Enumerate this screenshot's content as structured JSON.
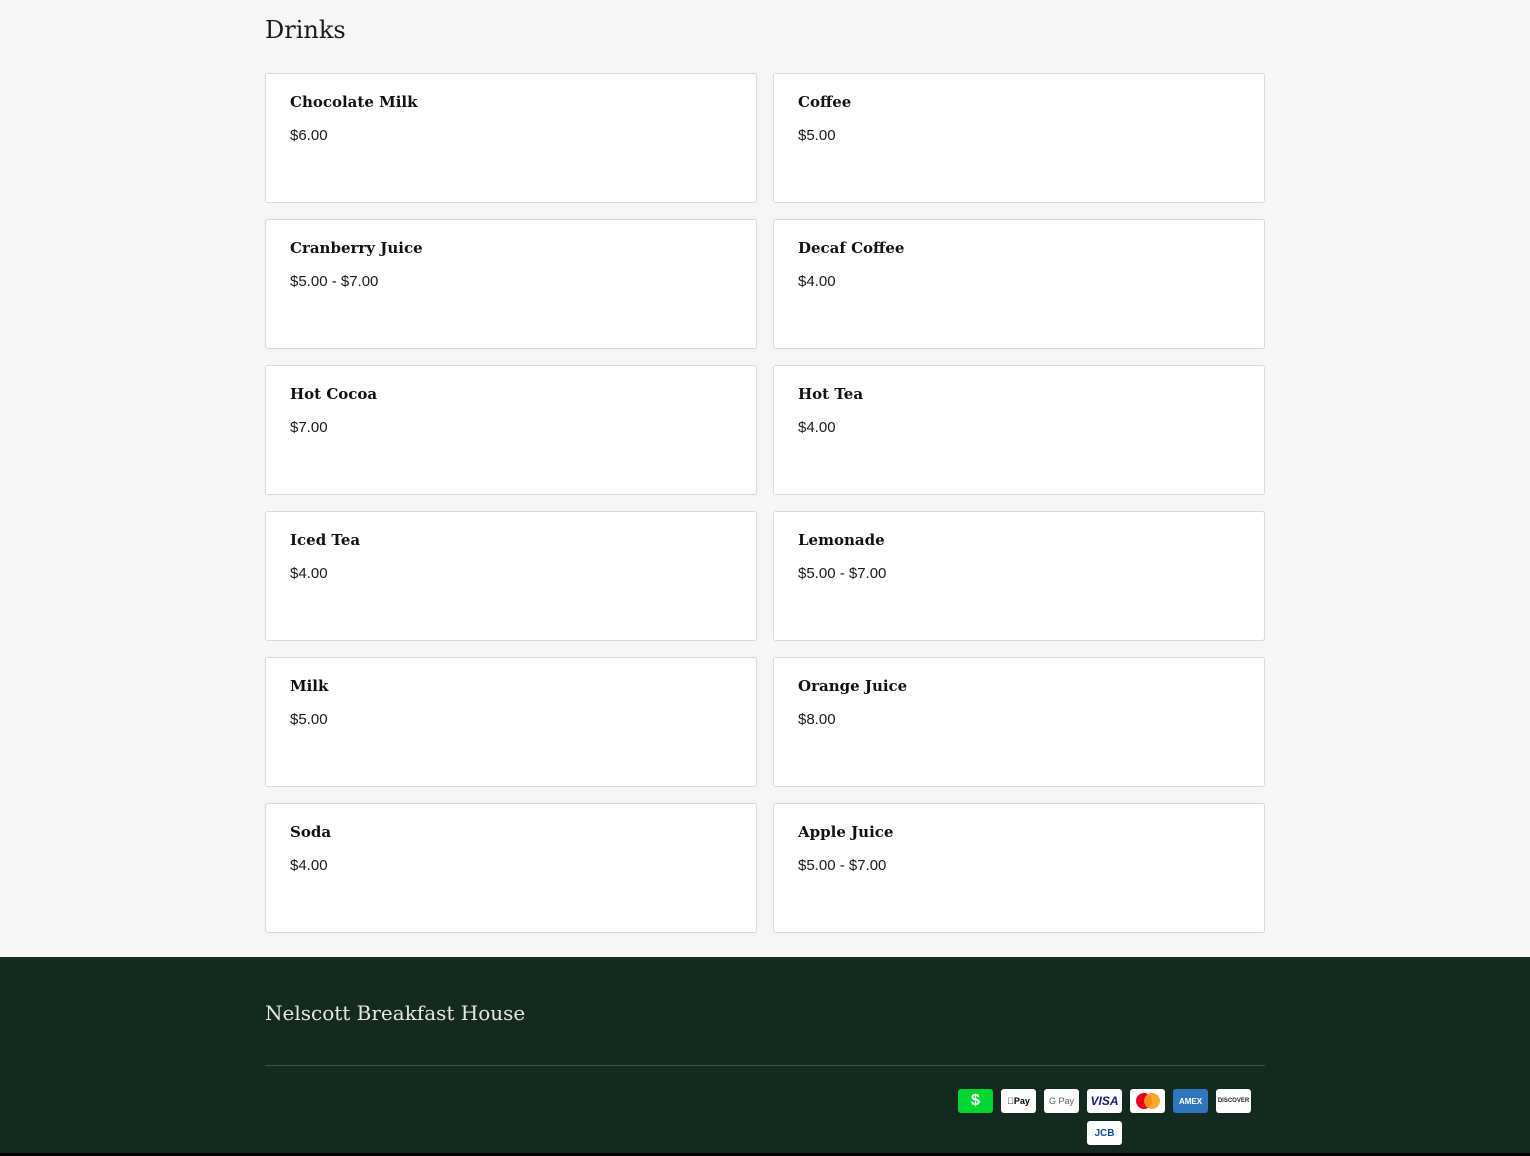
{
  "section": {
    "title": "Drinks"
  },
  "items": [
    {
      "name": "Chocolate Milk",
      "price": "$6.00"
    },
    {
      "name": "Coffee",
      "price": "$5.00"
    },
    {
      "name": "Cranberry Juice",
      "price": "$5.00 - $7.00"
    },
    {
      "name": "Decaf Coffee",
      "price": "$4.00"
    },
    {
      "name": "Hot Cocoa",
      "price": "$7.00"
    },
    {
      "name": "Hot Tea",
      "price": "$4.00"
    },
    {
      "name": "Iced Tea",
      "price": "$4.00"
    },
    {
      "name": "Lemonade",
      "price": "$5.00 - $7.00"
    },
    {
      "name": "Milk",
      "price": "$5.00"
    },
    {
      "name": "Orange Juice",
      "price": "$8.00"
    },
    {
      "name": "Soda",
      "price": "$4.00"
    },
    {
      "name": "Apple Juice",
      "price": "$5.00 - $7.00"
    }
  ],
  "footer": {
    "brand": "Nelscott Breakfast House",
    "payment_icons": [
      {
        "name": "cash-app-icon",
        "glyph": "$"
      },
      {
        "name": "apple-pay-icon",
        "glyph": "Pay"
      },
      {
        "name": "google-pay-icon",
        "glyph": "G Pay"
      },
      {
        "name": "visa-icon",
        "glyph": "VISA"
      },
      {
        "name": "mastercard-icon",
        "glyph": ""
      },
      {
        "name": "american-express-icon",
        "glyph": "AMEX"
      },
      {
        "name": "discover-icon",
        "glyph": "DISCOVER"
      },
      {
        "name": "jcb-icon",
        "glyph": "JCB"
      }
    ]
  },
  "colors": {
    "page_bg": "#f6f6f6",
    "footer_bg": "#132a1f",
    "card_border": "#dadada"
  }
}
